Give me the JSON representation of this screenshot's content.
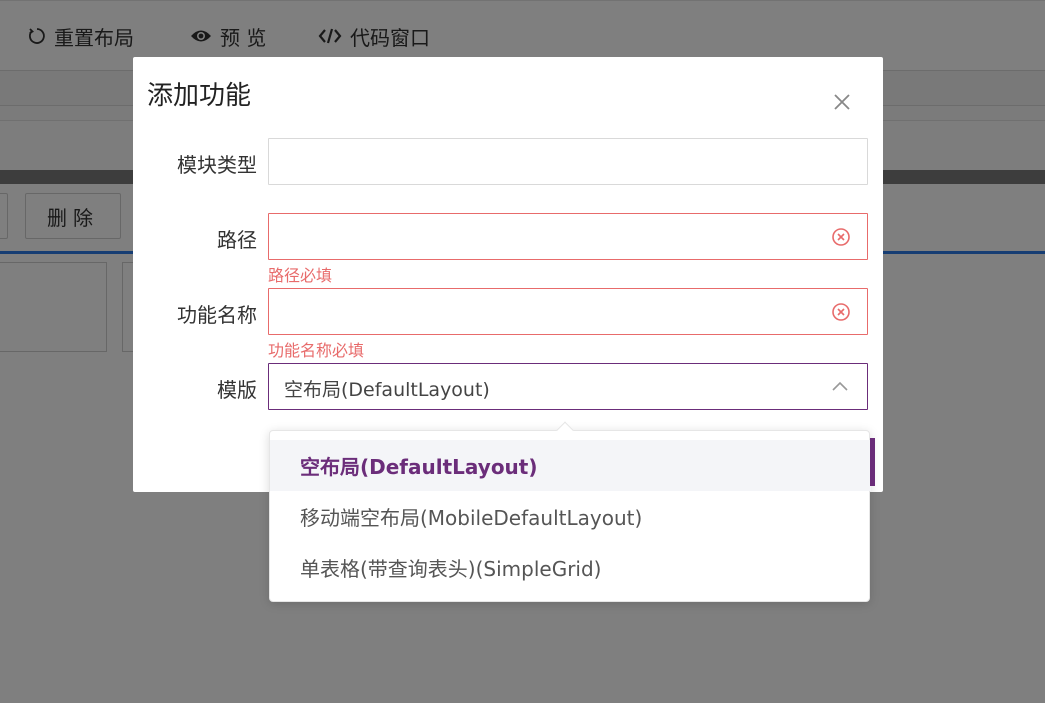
{
  "toolbar": {
    "reset_layout": "重置布局",
    "preview": "预 览",
    "code_window": "代码窗口"
  },
  "background": {
    "delete_label": "删除"
  },
  "modal": {
    "title": "添加功能",
    "fields": {
      "module_type": {
        "label": "模块类型",
        "value": ""
      },
      "path": {
        "label": "路径",
        "value": "",
        "error": "路径必填"
      },
      "function_name": {
        "label": "功能名称",
        "value": "",
        "error": "功能名称必填"
      },
      "template": {
        "label": "模版",
        "value": "空布局(DefaultLayout)"
      }
    }
  },
  "dropdown": {
    "options": [
      "空布局(DefaultLayout)",
      "移动端空布局(MobileDefaultLayout)",
      "单表格(带查询表头)(SimpleGrid)"
    ],
    "selected_index": 0
  },
  "colors": {
    "accent": "#6b2d7a",
    "error": "#e86b6b",
    "link_blue": "#2d7be6"
  },
  "icons": {
    "reset": "reset-icon",
    "preview": "eye-icon",
    "code": "code-icon",
    "close": "close-icon",
    "clear": "clear-circle-icon",
    "chevron": "chevron-up-icon"
  }
}
